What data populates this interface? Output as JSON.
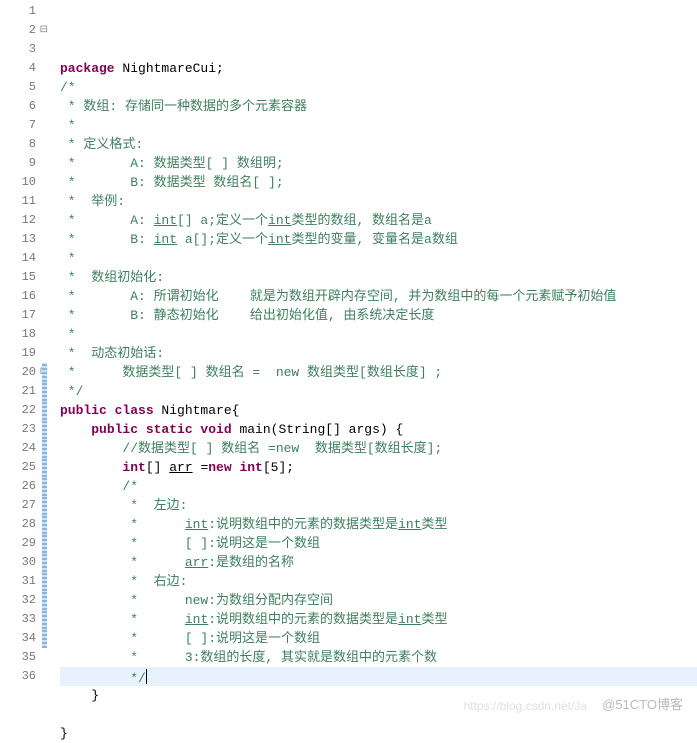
{
  "lines": [
    {
      "n": 1,
      "fold": "",
      "segs": [
        {
          "t": "package ",
          "c": "kw"
        },
        {
          "t": "NightmareCui;",
          "c": "id"
        }
      ]
    },
    {
      "n": 2,
      "fold": "⊟",
      "segs": [
        {
          "t": "/*",
          "c": "cm"
        }
      ]
    },
    {
      "n": 3,
      "segs": [
        {
          "t": " * 数组: 存储同一种数据的多个元素容器",
          "c": "cm"
        }
      ]
    },
    {
      "n": 4,
      "segs": [
        {
          "t": " *",
          "c": "cm"
        }
      ]
    },
    {
      "n": 5,
      "segs": [
        {
          "t": " * 定义格式:",
          "c": "cm"
        }
      ]
    },
    {
      "n": 6,
      "segs": [
        {
          "t": " *       A: 数据类型[ ] 数组明;",
          "c": "cm"
        }
      ]
    },
    {
      "n": 7,
      "segs": [
        {
          "t": " *       B: 数据类型 数组名[ ];",
          "c": "cm"
        }
      ]
    },
    {
      "n": 8,
      "segs": [
        {
          "t": " *  举例:",
          "c": "cm"
        }
      ]
    },
    {
      "n": 9,
      "segs": [
        {
          "t": " *       A: ",
          "c": "cm"
        },
        {
          "t": "int",
          "c": "cm underline"
        },
        {
          "t": "[] a;定义一个",
          "c": "cm"
        },
        {
          "t": "int",
          "c": "cm underline"
        },
        {
          "t": "类型的数组, 数组名是a",
          "c": "cm"
        }
      ]
    },
    {
      "n": 10,
      "segs": [
        {
          "t": " *       B: ",
          "c": "cm"
        },
        {
          "t": "int",
          "c": "cm underline"
        },
        {
          "t": " a[];定义一个",
          "c": "cm"
        },
        {
          "t": "int",
          "c": "cm underline"
        },
        {
          "t": "类型的变量, 变量名是a数组",
          "c": "cm"
        }
      ]
    },
    {
      "n": 11,
      "segs": [
        {
          "t": " *",
          "c": "cm"
        }
      ]
    },
    {
      "n": 12,
      "segs": [
        {
          "t": " *  数组初始化:",
          "c": "cm"
        }
      ]
    },
    {
      "n": 13,
      "segs": [
        {
          "t": " *       A: 所谓初始化    就是为数组开辟内存空间, 并为数组中的每一个元素赋予初始值",
          "c": "cm"
        }
      ]
    },
    {
      "n": 14,
      "segs": [
        {
          "t": " *       B: 静态初始化    给出初始化值, 由系统决定长度",
          "c": "cm"
        }
      ]
    },
    {
      "n": 15,
      "segs": [
        {
          "t": " *",
          "c": "cm"
        }
      ]
    },
    {
      "n": 16,
      "segs": [
        {
          "t": " *  动态初始话:",
          "c": "cm"
        }
      ]
    },
    {
      "n": 17,
      "segs": [
        {
          "t": " *      数据类型[ ] 数组名 =  new 数组类型[数组长度] ;",
          "c": "cm"
        }
      ]
    },
    {
      "n": 18,
      "segs": [
        {
          "t": " */",
          "c": "cm"
        }
      ]
    },
    {
      "n": 19,
      "segs": [
        {
          "t": "public class ",
          "c": "kw"
        },
        {
          "t": "Nightmare{",
          "c": "id"
        }
      ]
    },
    {
      "n": 20,
      "fold": "⊟",
      "mark": "blue",
      "indent": 1,
      "segs": [
        {
          "t": "public static void ",
          "c": "kw"
        },
        {
          "t": "main(String[] args) {",
          "c": "id"
        }
      ]
    },
    {
      "n": 21,
      "mark": "blue",
      "indent": 2,
      "segs": [
        {
          "t": "//数据类型[ ] 数组名 =new  数据类型[数组长度];",
          "c": "cm"
        }
      ]
    },
    {
      "n": 22,
      "mark": "blue",
      "yellow": true,
      "indent": 2,
      "segs": [
        {
          "t": "int",
          "c": "kw"
        },
        {
          "t": "[] ",
          "c": "id"
        },
        {
          "t": "arr",
          "c": "id underline"
        },
        {
          "t": " =",
          "c": "id"
        },
        {
          "t": "new int",
          "c": "kw"
        },
        {
          "t": "[5];",
          "c": "id"
        }
      ]
    },
    {
      "n": 23,
      "mark": "blue",
      "indent": 2,
      "segs": [
        {
          "t": "/*",
          "c": "cm"
        }
      ]
    },
    {
      "n": 24,
      "mark": "blue",
      "indent": 2,
      "segs": [
        {
          "t": " *  左边:",
          "c": "cm"
        }
      ]
    },
    {
      "n": 25,
      "mark": "blue",
      "indent": 2,
      "segs": [
        {
          "t": " *      ",
          "c": "cm"
        },
        {
          "t": "int",
          "c": "cm underline"
        },
        {
          "t": ":说明数组中的元素的数据类型是",
          "c": "cm"
        },
        {
          "t": "int",
          "c": "cm underline"
        },
        {
          "t": "类型",
          "c": "cm"
        }
      ]
    },
    {
      "n": 26,
      "mark": "blue",
      "indent": 2,
      "segs": [
        {
          "t": " *      [ ]:说明这是一个数组",
          "c": "cm"
        }
      ]
    },
    {
      "n": 27,
      "mark": "blue",
      "indent": 2,
      "segs": [
        {
          "t": " *      ",
          "c": "cm"
        },
        {
          "t": "arr",
          "c": "cm underline"
        },
        {
          "t": ":是数组的名称",
          "c": "cm"
        }
      ]
    },
    {
      "n": 28,
      "mark": "blue",
      "indent": 2,
      "segs": [
        {
          "t": " *  右边:",
          "c": "cm"
        }
      ]
    },
    {
      "n": 29,
      "mark": "blue",
      "indent": 2,
      "segs": [
        {
          "t": " *      new:为数组分配内存空间",
          "c": "cm"
        }
      ]
    },
    {
      "n": 30,
      "mark": "blue",
      "indent": 2,
      "segs": [
        {
          "t": " *      ",
          "c": "cm"
        },
        {
          "t": "int",
          "c": "cm underline"
        },
        {
          "t": ":说明数组中的元素的数据类型是",
          "c": "cm"
        },
        {
          "t": "int",
          "c": "cm underline"
        },
        {
          "t": "类型",
          "c": "cm"
        }
      ]
    },
    {
      "n": 31,
      "mark": "blue",
      "indent": 2,
      "segs": [
        {
          "t": " *      [ ]:说明这是一个数组",
          "c": "cm"
        }
      ]
    },
    {
      "n": 32,
      "mark": "blue",
      "indent": 2,
      "segs": [
        {
          "t": " *      3:数组的长度, 其实就是数组中的元素个数",
          "c": "cm"
        }
      ]
    },
    {
      "n": 33,
      "mark": "blue",
      "highlight": true,
      "indent": 2,
      "segs": [
        {
          "t": " */",
          "c": "cm"
        }
      ],
      "caret": true
    },
    {
      "n": 34,
      "mark": "blue",
      "indent": 1,
      "segs": [
        {
          "t": "}",
          "c": "id"
        }
      ]
    },
    {
      "n": 35,
      "segs": [
        {
          "t": "",
          "c": "id"
        }
      ]
    },
    {
      "n": 36,
      "segs": [
        {
          "t": "}",
          "c": "id"
        }
      ]
    }
  ],
  "watermark_primary": "@51CTO博客",
  "watermark_secondary": "https://blog.csdn.net/Ja"
}
